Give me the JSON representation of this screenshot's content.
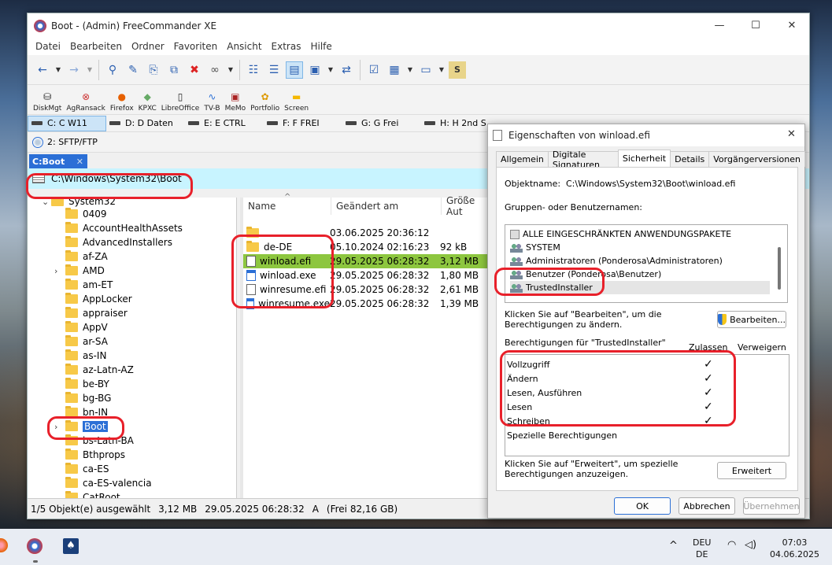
{
  "window": {
    "title": "Boot - (Admin) FreeCommander XE",
    "minimize": "—",
    "maximize": "☐",
    "close": "✕"
  },
  "menu": [
    "Datei",
    "Bearbeiten",
    "Ordner",
    "Favoriten",
    "Ansicht",
    "Extras",
    "Hilfe"
  ],
  "tools": [
    "DiskMgt",
    "AgRansack",
    "Firefox",
    "KPXC",
    "LibreOffice",
    "TV-B",
    "MeMo",
    "Portfolio",
    "Screen"
  ],
  "drives": [
    "C: C W11",
    "D: D Daten",
    "E: E CTRL",
    "F: F FREI",
    "G: G Frei",
    "H: H 2nd S"
  ],
  "ftp": "2: SFTP/FTP",
  "tab": {
    "label": "C:Boot",
    "close": "✕"
  },
  "path": "C:\\Windows\\System32\\Boot",
  "tree": {
    "parent": "System32",
    "items": [
      "0409",
      "AccountHealthAssets",
      "AdvancedInstallers",
      "af-ZA",
      "AMD",
      "am-ET",
      "AppLocker",
      "appraiser",
      "AppV",
      "ar-SA",
      "as-IN",
      "az-Latn-AZ",
      "be-BY",
      "bg-BG",
      "bn-IN",
      "Boot",
      "bs-Latn-BA",
      "Bthprops",
      "ca-ES",
      "ca-ES-valencia",
      "CatRoot"
    ],
    "expandable": [
      4,
      15
    ],
    "selected": 15
  },
  "files": {
    "headers": {
      "name": "Name",
      "changed": "Geändert am",
      "size": "Größe Aut"
    },
    "rows": [
      {
        "name": "..",
        "changed": "03.06.2025 20:36:12",
        "size": "",
        "type": "folder"
      },
      {
        "name": "de-DE",
        "changed": "05.10.2024 02:16:23",
        "size": "92 kB",
        "type": "folder"
      },
      {
        "name": "winload.efi",
        "changed": "29.05.2025 06:28:32",
        "size": "3,12 MB",
        "type": "file"
      },
      {
        "name": "winload.exe",
        "changed": "29.05.2025 06:28:32",
        "size": "1,80 MB",
        "type": "exe"
      },
      {
        "name": "winresume.efi",
        "changed": "29.05.2025 06:28:32",
        "size": "2,61 MB",
        "type": "file"
      },
      {
        "name": "winresume.exe",
        "changed": "29.05.2025 06:28:32",
        "size": "1,39 MB",
        "type": "exe"
      }
    ],
    "selected": 2
  },
  "status": {
    "count": "1/5 Objekt(e) ausgewählt",
    "size": "3,12 MB",
    "date": "29.05.2025 06:28:32",
    "attr": "A",
    "free": "(Frei 82,16 GB)"
  },
  "dialog": {
    "title": "Eigenschaften von winload.efi",
    "close": "✕",
    "tabs": [
      "Allgemein",
      "Digitale Signaturen",
      "Sicherheit",
      "Details",
      "Vorgängerversionen"
    ],
    "active_tab": 2,
    "object_label": "Objektname:",
    "object_value": "C:\\Windows\\System32\\Boot\\winload.efi",
    "groups_label": "Gruppen- oder Benutzernamen:",
    "groups": [
      "ALLE EINGESCHRÄNKTEN ANWENDUNGSPAKETE",
      "SYSTEM",
      "Administratoren (Ponderosa\\Administratoren)",
      "Benutzer (Ponderosa\\Benutzer)",
      "TrustedInstaller"
    ],
    "selected_group": 4,
    "edit_hint": "Klicken Sie auf \"Bearbeiten\", um die Berechtigungen zu ändern.",
    "edit_button": "Bearbeiten...",
    "perms_label": "Berechtigungen für \"TrustedInstaller\"",
    "allow_header": "Zulassen",
    "deny_header": "Verweigern",
    "permissions": [
      {
        "name": "Vollzugriff",
        "allow": "✓"
      },
      {
        "name": "Ändern",
        "allow": "✓"
      },
      {
        "name": "Lesen, Ausführen",
        "allow": "✓"
      },
      {
        "name": "Lesen",
        "allow": "✓"
      },
      {
        "name": "Schreiben",
        "allow": "✓"
      },
      {
        "name": "Spezielle Berechtigungen",
        "allow": ""
      }
    ],
    "advanced_hint": "Klicken Sie auf \"Erweitert\", um spezielle Berechtigungen anzuzeigen.",
    "advanced_button": "Erweitert",
    "ok": "OK",
    "cancel": "Abbrechen",
    "apply": "Übernehmen"
  },
  "taskbar": {
    "lang1": "DEU",
    "lang2": "DE",
    "time": "07:03",
    "date": "04.06.2025"
  },
  "colors": {
    "accent": "#2b6fd6",
    "highlight": "#8dc63f",
    "pathbar": "#c8f4ff",
    "annotation": "#e8202a"
  }
}
